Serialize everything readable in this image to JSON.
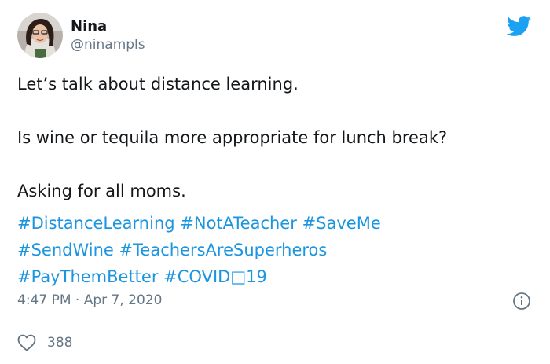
{
  "author": {
    "name": "Nina",
    "handle": "@ninampls"
  },
  "tweet": {
    "line1": "Let’s talk about distance learning.",
    "line2": "Is wine or tequila more appropriate for lunch break?",
    "line3": "Asking for all moms.",
    "hashtags": [
      "#DistanceLearning",
      "#NotATeacher",
      "#SaveMe",
      "#SendWine",
      "#TeachersAreSuperheros",
      "#PayThemBetter",
      "#COVID□19"
    ]
  },
  "meta": {
    "timestamp": "4:47 PM · Apr 7, 2020"
  },
  "engagement": {
    "likes": "388"
  },
  "colors": {
    "accent": "#1b95e0",
    "twitter_blue": "#1da1f2",
    "muted": "#657786",
    "divider": "#e1e8ed"
  },
  "icons": {
    "brand": "twitter-bird-icon",
    "info": "info-icon",
    "like": "heart-icon"
  }
}
